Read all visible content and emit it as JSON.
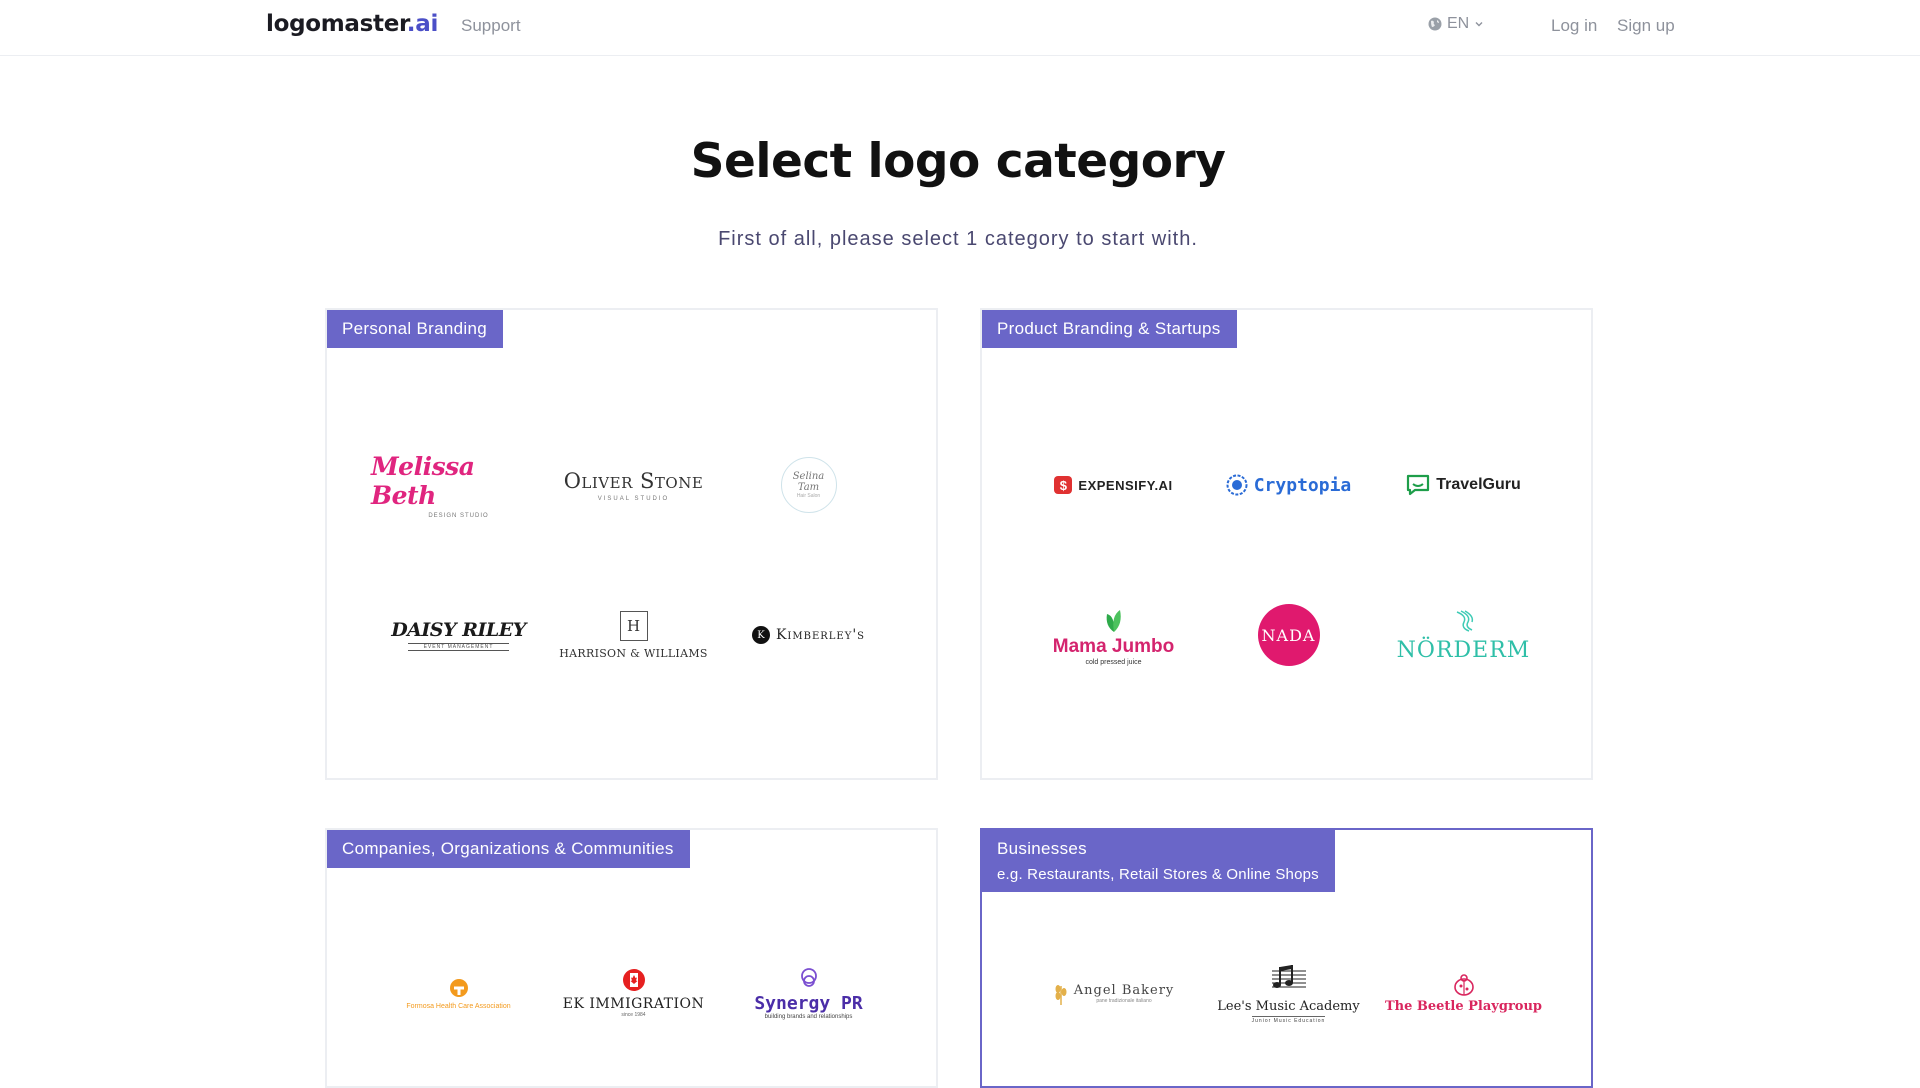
{
  "header": {
    "brand": "logomaster",
    "brand_tld": ".ai",
    "support": "Support",
    "language": "EN",
    "login": "Log in",
    "signup": "Sign up"
  },
  "main": {
    "title": "Select logo category",
    "subtitle": "First of all, please select 1 category to start with."
  },
  "categories": [
    {
      "label": "Personal Branding",
      "logos": [
        {
          "name": "Melissa Beth",
          "sub": "DESIGN STUDIO"
        },
        {
          "name": "Oliver Stone",
          "sub": "VISUAL STUDIO"
        },
        {
          "name": "Selina Tam",
          "sub": "Hair Salon"
        },
        {
          "name": "DAISY RILEY",
          "sub": "EVENT MANAGEMENT"
        },
        {
          "name": "HARRISON & WILLIAMS",
          "mark": "H"
        },
        {
          "name": "Kimberley's",
          "mark": "K"
        }
      ]
    },
    {
      "label": "Product Branding & Startups",
      "logos": [
        {
          "name": "EXPENSIFY.AI"
        },
        {
          "name": "Cryptopia"
        },
        {
          "name": "TravelGuru"
        },
        {
          "name": "Mama Jumbo",
          "sub": "cold pressed juice"
        },
        {
          "name": "NADA"
        },
        {
          "name": "NÖRDERM"
        }
      ]
    },
    {
      "label": "Companies, Organizations & Communities",
      "logos": [
        {
          "name": "Formosa Health Care Association"
        },
        {
          "name": "EK IMMIGRATION",
          "sub": "since 1984"
        },
        {
          "name": "Synergy PR",
          "sub": "building brands and relationships"
        }
      ]
    },
    {
      "label": "Businesses",
      "sublabel": "e.g. Restaurants, Retail Stores & Online Shops",
      "logos": [
        {
          "name": "Angel Bakery",
          "sub": "pane tradizionale italiano"
        },
        {
          "name": "Lee's Music Academy",
          "sub": "Junior Music Education"
        },
        {
          "name": "The Beetle Playgroup"
        }
      ]
    }
  ],
  "colors": {
    "accent": "#6a66c8",
    "brand_tld": "#4b4fc7",
    "nav_text": "#8e929c"
  }
}
